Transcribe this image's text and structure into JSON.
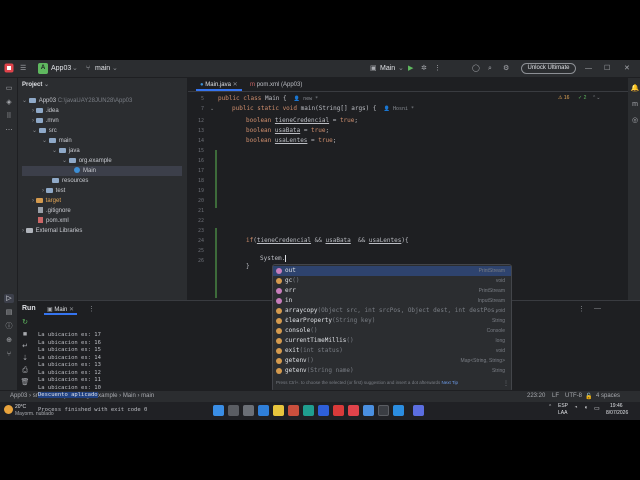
{
  "titlebar": {
    "project_initials": "A",
    "project": "App03",
    "branch": "main",
    "run_config": "Main",
    "unlock_label": "Unlock Ultimate"
  },
  "project_panel": {
    "title": "Project",
    "items": [
      {
        "label": "App03",
        "path": "C:\\javaUAY28JUN28\\App03"
      },
      {
        "label": ".idea"
      },
      {
        "label": ".mvn"
      },
      {
        "label": "src"
      },
      {
        "label": "main"
      },
      {
        "label": "java"
      },
      {
        "label": "org.example"
      },
      {
        "label": "Main"
      },
      {
        "label": "resources"
      },
      {
        "label": "test"
      },
      {
        "label": "target"
      },
      {
        "label": ".gitignore"
      },
      {
        "label": "pom.xml"
      },
      {
        "label": "External Libraries"
      }
    ]
  },
  "tabs": [
    {
      "label": "Main.java"
    },
    {
      "label": "pom.xml (App03)"
    }
  ],
  "editor": {
    "warnings": "16",
    "ok": "2",
    "lines": [
      {
        "n": "5",
        "text": "public class Main {",
        "hint": "new *"
      },
      {
        "n": "7",
        "text": "public static void main(String[] args) {",
        "hint": "Hosni *"
      },
      {
        "n": "12",
        "text": "boolean tieneCredencial = true;"
      },
      {
        "n": "13",
        "text": "boolean usaBata = true;"
      },
      {
        "n": "14",
        "text": "boolean usaLentes = true;"
      },
      {
        "n": "15",
        "text": ""
      },
      {
        "n": "16",
        "text": ""
      },
      {
        "n": "17",
        "text": ""
      },
      {
        "n": "18",
        "text": ""
      },
      {
        "n": "19",
        "text": ""
      },
      {
        "n": "20",
        "text": "if(tieneCredencial && usaBata  && usaLentes){"
      },
      {
        "n": "21",
        "text": ""
      },
      {
        "n": "22",
        "text": ""
      },
      {
        "n": "23",
        "text": "System."
      },
      {
        "n": "24",
        "text": "}"
      },
      {
        "n": "25",
        "text": ""
      },
      {
        "n": "26",
        "text": ""
      }
    ]
  },
  "completion": {
    "items": [
      {
        "name": "out",
        "sig": "",
        "type": "PrintStream"
      },
      {
        "name": "gc",
        "sig": "()",
        "type": "void"
      },
      {
        "name": "err",
        "sig": "",
        "type": "PrintStream"
      },
      {
        "name": "in",
        "sig": "",
        "type": "InputStream"
      },
      {
        "name": "arraycopy",
        "sig": "(Object src, int srcPos, Object dest, int destPos, i...",
        "type": "void"
      },
      {
        "name": "clearProperty",
        "sig": "(String key)",
        "type": "String"
      },
      {
        "name": "console",
        "sig": "()",
        "type": "Console"
      },
      {
        "name": "currentTimeMillis",
        "sig": "()",
        "type": "long"
      },
      {
        "name": "exit",
        "sig": "(int status)",
        "type": "void"
      },
      {
        "name": "getenv",
        "sig": "()",
        "type": "Map<String, String>"
      },
      {
        "name": "getenv",
        "sig": "(String name)",
        "type": "String"
      }
    ],
    "footer": "Press Ctrl+. to choose the selected (or first) suggestion and insert a dot afterwards",
    "next_tip": "Next Tip"
  },
  "run_panel": {
    "title": "Run",
    "tab": "Main",
    "output": [
      "La ubicacion es: 17",
      "La ubicacion es: 16",
      "La ubicacion es: 15",
      "La ubicacion es: 14",
      "La ubicacion es: 13",
      "La ubicacion es: 12",
      "La ubicacion es: 11",
      "La ubicacion es: 10"
    ],
    "highlight": "Descuento aplicado",
    "exit_line": "Process finished with exit code 0"
  },
  "statusbar": {
    "breadcrumb": [
      "App03",
      "src",
      "main",
      "java",
      "org",
      "example",
      "Main",
      "main"
    ],
    "position": "223:20",
    "line_sep": "LF",
    "encoding": "UTF-8",
    "indent": "4 spaces"
  },
  "taskbar": {
    "weather_temp": "20°C",
    "weather_desc": "Mayorm. nublado",
    "lang": "ESP",
    "lang2": "LAA",
    "time": "19:46",
    "date": "8/07/2026"
  }
}
